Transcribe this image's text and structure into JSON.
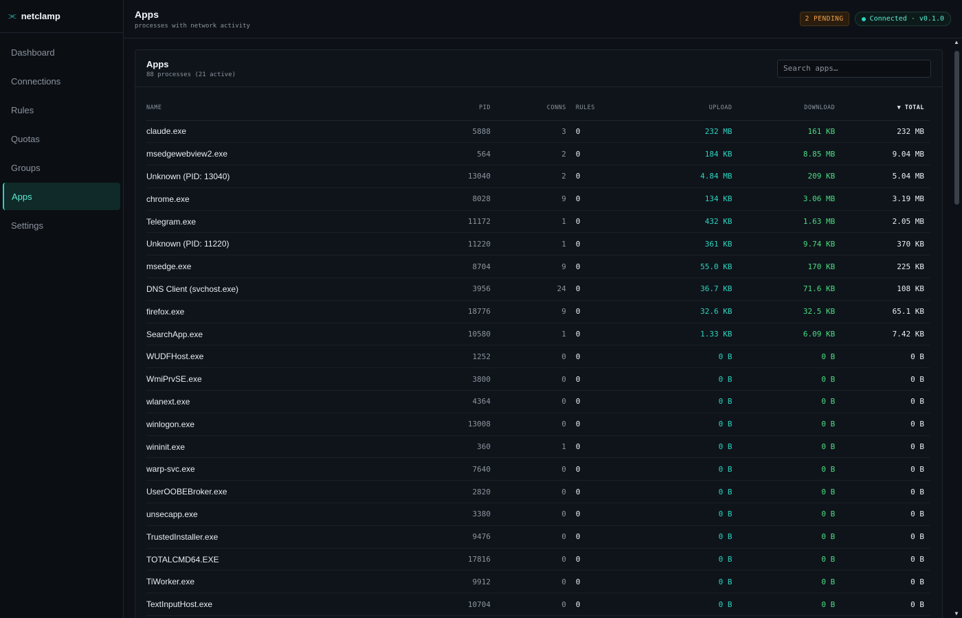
{
  "brand": {
    "name": "netclamp",
    "logo": "⫘"
  },
  "nav": [
    {
      "label": "Dashboard",
      "active": false
    },
    {
      "label": "Connections",
      "active": false
    },
    {
      "label": "Rules",
      "active": false
    },
    {
      "label": "Quotas",
      "active": false
    },
    {
      "label": "Groups",
      "active": false
    },
    {
      "label": "Apps",
      "active": true
    },
    {
      "label": "Settings",
      "active": false
    }
  ],
  "header": {
    "title": "Apps",
    "subtitle": "processes with network activity",
    "pending": "2 PENDING",
    "status": "Connected · v0.1.0"
  },
  "card": {
    "title": "Apps",
    "subtitle": "88 processes (21 active)",
    "search_placeholder": "Search apps…"
  },
  "columns": {
    "name": "NAME",
    "pid": "PID",
    "conns": "CONNS",
    "rules": "RULES",
    "upload": "UPLOAD",
    "download": "DOWNLOAD",
    "total": "▼ TOTAL"
  },
  "rows": [
    {
      "name": "claude.exe",
      "pid": "5888",
      "conns": "3",
      "rules": "0",
      "upload": "232 MB",
      "download": "161 KB",
      "total": "232 MB"
    },
    {
      "name": "msedgewebview2.exe",
      "pid": "564",
      "conns": "2",
      "rules": "0",
      "upload": "184 KB",
      "download": "8.85 MB",
      "total": "9.04 MB"
    },
    {
      "name": "Unknown (PID: 13040)",
      "pid": "13040",
      "conns": "2",
      "rules": "0",
      "upload": "4.84 MB",
      "download": "209 KB",
      "total": "5.04 MB"
    },
    {
      "name": "chrome.exe",
      "pid": "8028",
      "conns": "9",
      "rules": "0",
      "upload": "134 KB",
      "download": "3.06 MB",
      "total": "3.19 MB"
    },
    {
      "name": "Telegram.exe",
      "pid": "11172",
      "conns": "1",
      "rules": "0",
      "upload": "432 KB",
      "download": "1.63 MB",
      "total": "2.05 MB"
    },
    {
      "name": "Unknown (PID: 11220)",
      "pid": "11220",
      "conns": "1",
      "rules": "0",
      "upload": "361 KB",
      "download": "9.74 KB",
      "total": "370 KB"
    },
    {
      "name": "msedge.exe",
      "pid": "8704",
      "conns": "9",
      "rules": "0",
      "upload": "55.0 KB",
      "download": "170 KB",
      "total": "225 KB"
    },
    {
      "name": "DNS Client (svchost.exe)",
      "pid": "3956",
      "conns": "24",
      "rules": "0",
      "upload": "36.7 KB",
      "download": "71.6 KB",
      "total": "108 KB"
    },
    {
      "name": "firefox.exe",
      "pid": "18776",
      "conns": "9",
      "rules": "0",
      "upload": "32.6 KB",
      "download": "32.5 KB",
      "total": "65.1 KB"
    },
    {
      "name": "SearchApp.exe",
      "pid": "10580",
      "conns": "1",
      "rules": "0",
      "upload": "1.33 KB",
      "download": "6.09 KB",
      "total": "7.42 KB"
    },
    {
      "name": "WUDFHost.exe",
      "pid": "1252",
      "conns": "0",
      "rules": "0",
      "upload": "0 B",
      "download": "0 B",
      "total": "0 B"
    },
    {
      "name": "WmiPrvSE.exe",
      "pid": "3800",
      "conns": "0",
      "rules": "0",
      "upload": "0 B",
      "download": "0 B",
      "total": "0 B"
    },
    {
      "name": "wlanext.exe",
      "pid": "4364",
      "conns": "0",
      "rules": "0",
      "upload": "0 B",
      "download": "0 B",
      "total": "0 B"
    },
    {
      "name": "winlogon.exe",
      "pid": "13008",
      "conns": "0",
      "rules": "0",
      "upload": "0 B",
      "download": "0 B",
      "total": "0 B"
    },
    {
      "name": "wininit.exe",
      "pid": "360",
      "conns": "1",
      "rules": "0",
      "upload": "0 B",
      "download": "0 B",
      "total": "0 B"
    },
    {
      "name": "warp-svc.exe",
      "pid": "7640",
      "conns": "0",
      "rules": "0",
      "upload": "0 B",
      "download": "0 B",
      "total": "0 B"
    },
    {
      "name": "UserOOBEBroker.exe",
      "pid": "2820",
      "conns": "0",
      "rules": "0",
      "upload": "0 B",
      "download": "0 B",
      "total": "0 B"
    },
    {
      "name": "unsecapp.exe",
      "pid": "3380",
      "conns": "0",
      "rules": "0",
      "upload": "0 B",
      "download": "0 B",
      "total": "0 B"
    },
    {
      "name": "TrustedInstaller.exe",
      "pid": "9476",
      "conns": "0",
      "rules": "0",
      "upload": "0 B",
      "download": "0 B",
      "total": "0 B"
    },
    {
      "name": "TOTALCMD64.EXE",
      "pid": "17816",
      "conns": "0",
      "rules": "0",
      "upload": "0 B",
      "download": "0 B",
      "total": "0 B"
    },
    {
      "name": "TiWorker.exe",
      "pid": "9912",
      "conns": "0",
      "rules": "0",
      "upload": "0 B",
      "download": "0 B",
      "total": "0 B"
    },
    {
      "name": "TextInputHost.exe",
      "pid": "10704",
      "conns": "0",
      "rules": "0",
      "upload": "0 B",
      "download": "0 B",
      "total": "0 B"
    }
  ],
  "colors": {
    "accent": "#2dd4bf",
    "download": "#4ade80",
    "pending": "#f0a04b"
  }
}
